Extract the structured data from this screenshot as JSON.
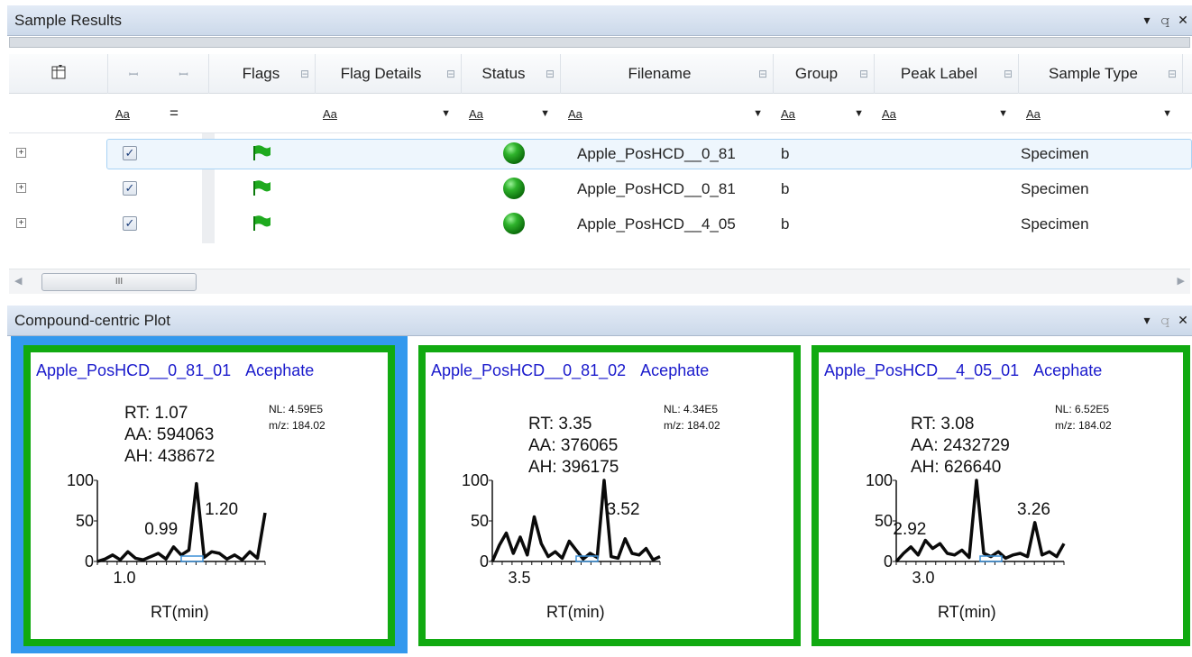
{
  "sample_results": {
    "title": "Sample Results",
    "controls": {
      "dropdown": "▾",
      "pin": "ꟷ",
      "close": "✕"
    },
    "columns": [
      {
        "label": "",
        "icon": "column-chooser-icon"
      },
      {
        "label": ""
      },
      {
        "label": ""
      },
      {
        "label": "Flags"
      },
      {
        "label": "Flag Details"
      },
      {
        "label": "Status"
      },
      {
        "label": "Filename"
      },
      {
        "label": "Group"
      },
      {
        "label": "Peak Label"
      },
      {
        "label": "Sample Type"
      }
    ],
    "filter_row": {
      "aa": "Aa",
      "eq": "="
    },
    "rows": [
      {
        "checked": true,
        "flag": "green",
        "status": "green",
        "filename": "Apple_PosHCD__0_81",
        "group": "b",
        "peak_label": "",
        "sample_type": "Specimen",
        "selected": true
      },
      {
        "checked": true,
        "flag": "green",
        "status": "green",
        "filename": "Apple_PosHCD__0_81",
        "group": "b",
        "peak_label": "",
        "sample_type": "Specimen",
        "selected": false
      },
      {
        "checked": true,
        "flag": "green",
        "status": "green",
        "filename": "Apple_PosHCD__4_05",
        "group": "b",
        "peak_label": "",
        "sample_type": "Specimen",
        "selected": false
      }
    ],
    "scroll_thumb": "III"
  },
  "compound_plot": {
    "title": "Compound-centric Plot",
    "colors": {
      "selected_border": "#3399ee",
      "card_border": "#11aa11",
      "title": "#1b1bcc"
    },
    "cards": [
      {
        "sample": "Apple_PosHCD__0_81_01",
        "compound": "Acephate",
        "rt": "RT: 1.07",
        "aa": "AA: 594063",
        "ah": "AH: 438672",
        "nl": "NL: 4.59E5",
        "mz": "m/z: 184.02",
        "xlabel": "RT(min)",
        "xtick": "1.0",
        "peak_labels": [
          "0.99",
          "1.20"
        ],
        "selected": true
      },
      {
        "sample": "Apple_PosHCD__0_81_02",
        "compound": "Acephate",
        "rt": "RT: 3.35",
        "aa": "AA: 376065",
        "ah": "AH: 396175",
        "nl": "NL: 4.34E5",
        "mz": "m/z: 184.02",
        "xlabel": "RT(min)",
        "xtick": "3.5",
        "peak_labels": [
          "3.52"
        ],
        "selected": false
      },
      {
        "sample": "Apple_PosHCD__4_05_01",
        "compound": "Acephate",
        "rt": "RT: 3.08",
        "aa": "AA: 2432729",
        "ah": "AH: 626640",
        "nl": "NL: 6.52E5",
        "mz": "m/z: 184.02",
        "xlabel": "RT(min)",
        "xtick": "3.0",
        "peak_labels": [
          "2.92",
          "3.26"
        ],
        "selected": false
      }
    ],
    "yticks": [
      "100",
      "50",
      "0"
    ]
  }
}
